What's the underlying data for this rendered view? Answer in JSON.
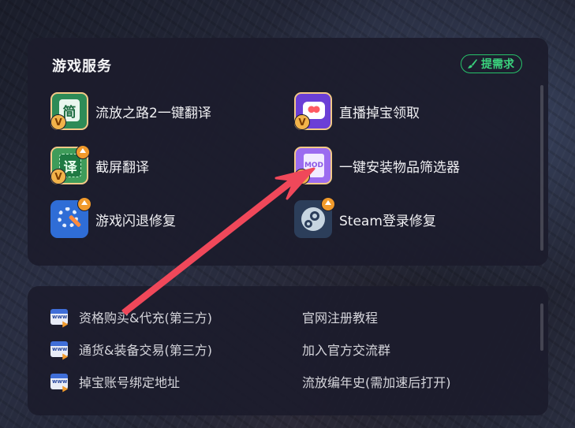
{
  "services": {
    "title": "游戏服务",
    "request_button": "提需求",
    "items": [
      {
        "label": "流放之路2一键翻译",
        "icon": "simplified-chinese-icon",
        "glyph": "简"
      },
      {
        "label": "直播掉宝领取",
        "icon": "live-drop-icon"
      },
      {
        "label": "截屏翻译",
        "icon": "screenshot-translate-icon",
        "glyph": "译"
      },
      {
        "label": "一键安装物品筛选器",
        "icon": "mod-file-icon",
        "glyph": "MOD"
      },
      {
        "label": "游戏闪退修复",
        "icon": "gear-repair-icon"
      },
      {
        "label": "Steam登录修复",
        "icon": "steam-icon"
      }
    ]
  },
  "links": {
    "items": [
      {
        "label": "资格购买&代充(第三方)",
        "icon": "www-icon"
      },
      {
        "label": "官网注册教程"
      },
      {
        "label": "通货&装备交易(第三方)",
        "icon": "www-icon"
      },
      {
        "label": "加入官方交流群"
      },
      {
        "label": "掉宝账号绑定地址",
        "icon": "www-icon"
      },
      {
        "label": "流放编年史(需加速后打开)"
      }
    ]
  },
  "colors": {
    "panel": "#1c1c2c",
    "accent_green": "#27c26a",
    "arrow": "#f0485a",
    "badge_v": "#f2b34a",
    "badge_update": "#f19a2b"
  }
}
